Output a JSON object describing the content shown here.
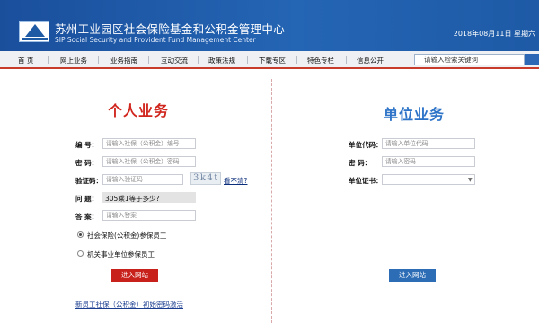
{
  "header": {
    "title_cn": "苏州工业园区社会保险基金和公积金管理中心",
    "title_en": "SIP Social Security and Provident Fund Management Center",
    "date": "2018年08月11日 星期六"
  },
  "nav": {
    "items": [
      "首 页",
      "网上业务",
      "业务指南",
      "互动交流",
      "政策法规",
      "下载专区",
      "特色专栏",
      "信息公开"
    ],
    "search_placeholder": "请输入检索关键词"
  },
  "personal": {
    "title": "个人业务",
    "id_label": "编    号：",
    "id_placeholder": "请输入社保（公积金）编号",
    "pwd_label": "密    码：",
    "pwd_placeholder": "请输入社保（公积金）密码",
    "captcha_label": "验证码：",
    "captcha_placeholder": "请输入验证码",
    "captcha_text": "3k4t",
    "captcha_refresh": "看不清?",
    "question_label": "问    题：",
    "question_text": "305乘1等于多少?",
    "answer_label": "答    案：",
    "answer_placeholder": "请输入答案",
    "radio_1": "社会保险(公积金)参保员工",
    "radio_2": "机关事业单位参保员工",
    "radio_selected": 1,
    "enter_button": "进入网站",
    "first_login_link": "新员工社保（公积金）初始密码激活"
  },
  "company": {
    "title": "单位业务",
    "code_label": "单位代码：",
    "code_placeholder": "请输入单位代码",
    "pwd_label": "密    码：",
    "pwd_placeholder": "请输入密码",
    "cert_label": "单位证书：",
    "enter_button": "进入网站"
  },
  "colors": {
    "header_blue": "#1d5aa8",
    "accent_red": "#d0261d",
    "accent_blue": "#2d73c8"
  }
}
